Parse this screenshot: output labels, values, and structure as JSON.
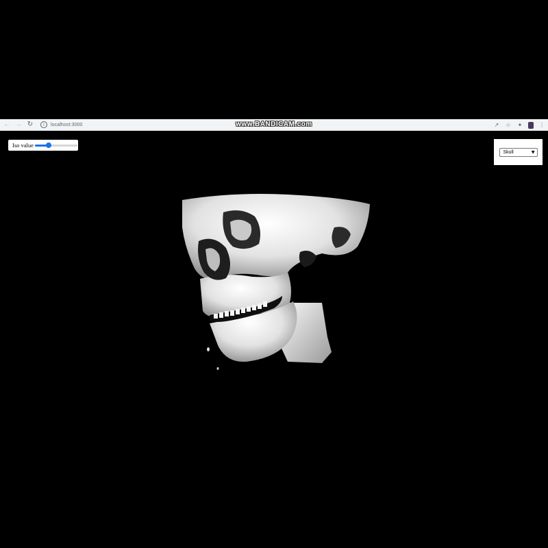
{
  "browser": {
    "url": "localhost:3000",
    "watermark": "www.BANDICAM.com",
    "icons": [
      "back-arrow-icon",
      "forward-arrow-icon",
      "reload-icon",
      "info-icon",
      "share-icon",
      "star-icon",
      "extensions-icon",
      "profile-avatar",
      "menu-icon"
    ]
  },
  "controls": {
    "iso_label": "Iso value",
    "iso_value_fraction": 0.33,
    "accent_color": "#1a73e8",
    "model_select": {
      "selected": "Skull"
    }
  },
  "viewport": {
    "background": "#000000",
    "model": "skull-isosurface"
  }
}
